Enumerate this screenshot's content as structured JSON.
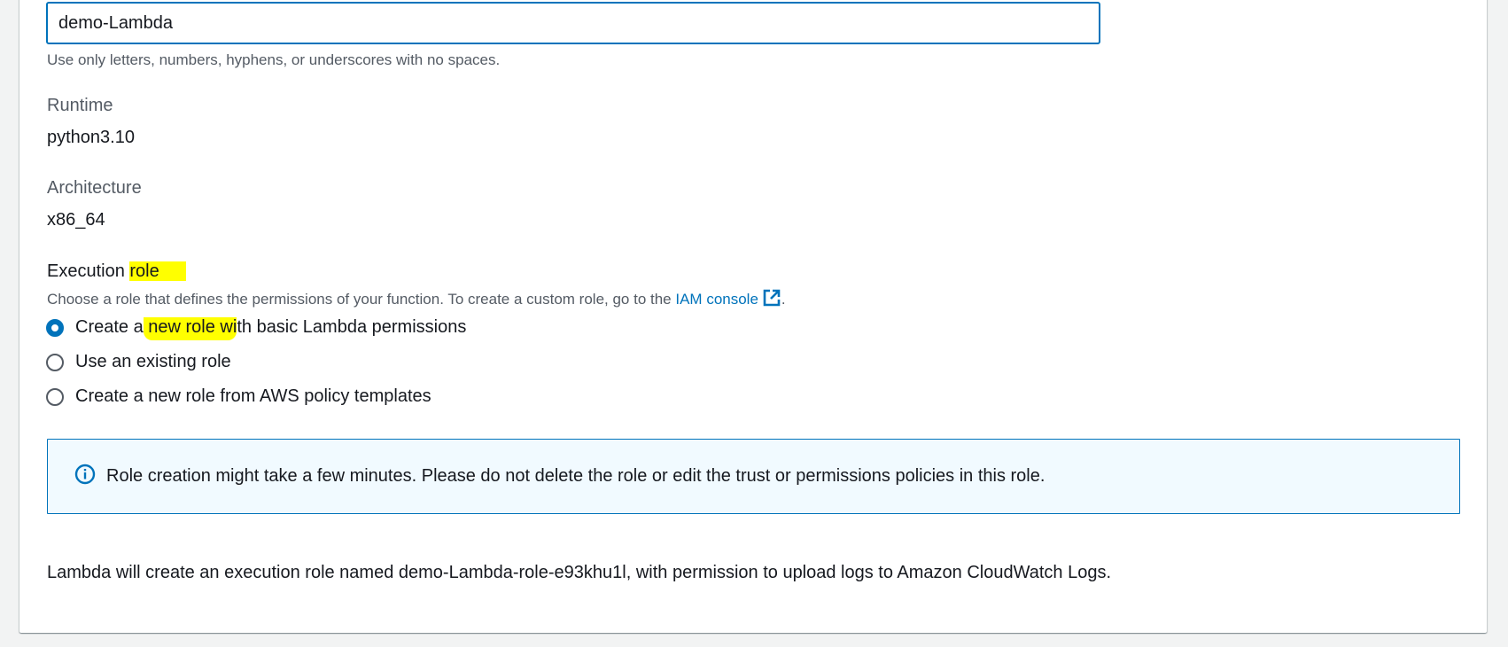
{
  "function_name": {
    "value": "demo-Lambda",
    "hint": "Use only letters, numbers, hyphens, or underscores with no spaces."
  },
  "runtime": {
    "label": "Runtime",
    "value": "python3.10"
  },
  "architecture": {
    "label": "Architecture",
    "value": "x86_64"
  },
  "execution_role": {
    "heading_prefix": "Execution ",
    "heading_highlight": "role",
    "description": "Choose a role that defines the permissions of your function. To create a custom role, go to the ",
    "link_text": "IAM console",
    "description_suffix": ".",
    "options": [
      {
        "label_prefix": "Create a",
        "label_highlight": " new role wi",
        "label_suffix": "th basic Lambda permissions",
        "checked": true
      },
      {
        "label": "Use an existing role",
        "checked": false
      },
      {
        "label": "Create a new role from AWS policy templates",
        "checked": false
      }
    ]
  },
  "alert": {
    "icon": "info-icon",
    "text": "Role creation might take a few minutes. Please do not delete the role or edit the trust or permissions policies in this role."
  },
  "footer": {
    "text": "Lambda will create an execution role named demo-Lambda-role-e93khu1l, with permission to upload logs to Amazon CloudWatch Logs."
  },
  "colors": {
    "accent": "#0073bb",
    "highlight": "#ffff00",
    "alert_bg": "#f1faff",
    "secondary_text": "#545b64"
  }
}
